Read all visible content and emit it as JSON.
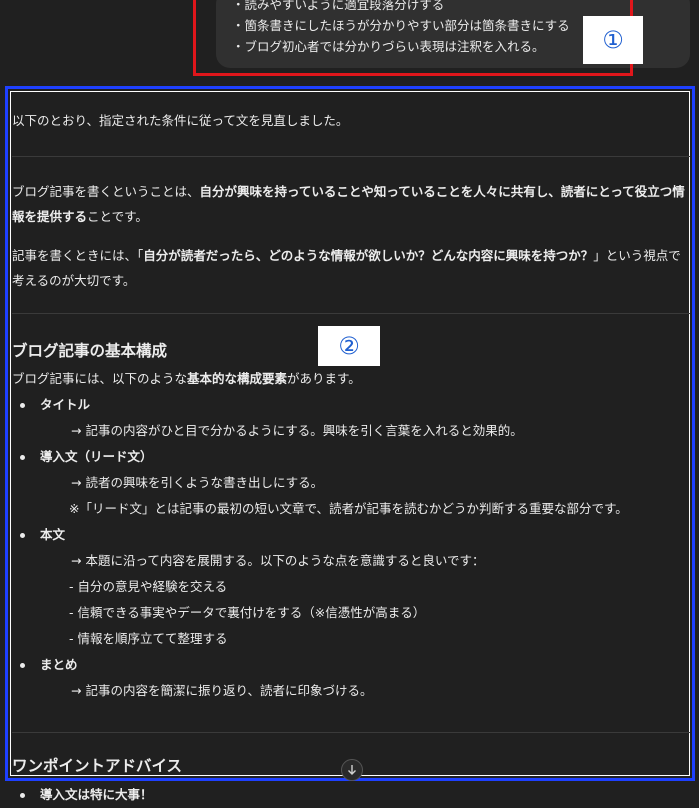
{
  "user_message": {
    "lines": [
      "・読みやすいように適宜段落分けする",
      "・箇条書きにしたほうが分かりやすい部分は箇条書きにする",
      "・ブログ初心者では分かりづらい表現は注釈を入れる。"
    ]
  },
  "annotations": {
    "label_1": "①",
    "label_2": "②"
  },
  "response": {
    "intro": "以下のとおり、指定された条件に従って文を見直しました。",
    "para1_a": "ブログ記事を書くということは、",
    "para1_bold": "自分が興味を持っていることや知っていることを人々に共有し、読者にとって役立つ情報を提供する",
    "para1_c": "ことです。",
    "para2_a": "記事を書くときには、「",
    "para2_bold": "自分が読者だったら、どのような情報が欲しいか？どんな内容に興味を持つか？",
    "para2_c": "」という視点で考えるのが大切です。",
    "section1_title": "ブログ記事の基本構成",
    "section1_intro_a": "ブログ記事には、以下のような",
    "section1_intro_bold": "基本的な構成要素",
    "section1_intro_c": "があります。",
    "items": [
      {
        "title": "タイトル",
        "lines": [
          "→ 記事の内容がひと目で分かるようにする。興味を引く言葉を入れると効果的。"
        ]
      },
      {
        "title": "導入文（リード文）",
        "lines": [
          "→ 読者の興味を引くような書き出しにする。",
          "※「リード文」とは記事の最初の短い文章で、読者が記事を読むかどうか判断する重要な部分です。"
        ]
      },
      {
        "title": "本文",
        "lines": [
          "→ 本題に沿って内容を展開する。以下のような点を意識すると良いです：",
          "- 自分の意見や経験を交える",
          "- 信頼できる事実やデータで裏付けをする（※信憑性が高まる）",
          "- 情報を順序立てて整理する"
        ]
      },
      {
        "title": "まとめ",
        "lines": [
          "→ 記事の内容を簡潔に振り返り、読者に印象づける。"
        ]
      }
    ],
    "section2_title": "ワンポイントアドバイス",
    "section2_first_bullet": "導入文は特に大事！"
  },
  "scroll_icon": "arrow-down-icon"
}
